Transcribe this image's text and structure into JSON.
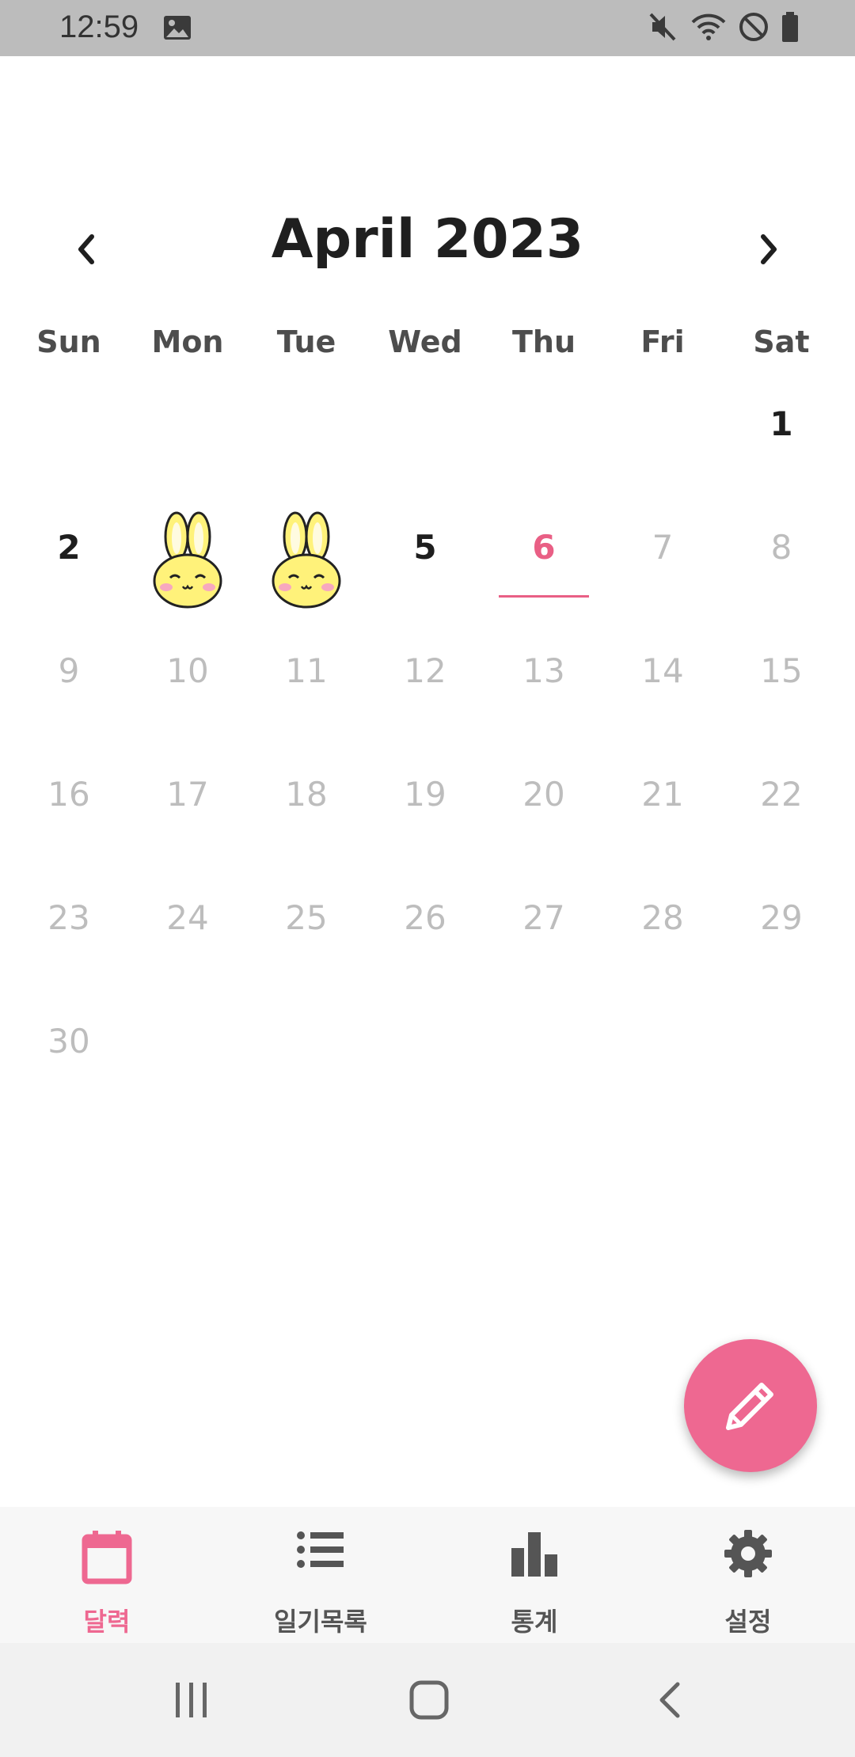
{
  "status_bar": {
    "time": "12:59",
    "left_icons": [
      "image-icon"
    ],
    "right_icons": [
      "mute-icon",
      "wifi-icon",
      "do-not-disturb-icon",
      "battery-icon"
    ]
  },
  "header": {
    "title": "April 2023",
    "prev_icon": "chevron-left-icon",
    "next_icon": "chevron-right-icon"
  },
  "weekdays": [
    "Sun",
    "Mon",
    "Tue",
    "Wed",
    "Thu",
    "Fri",
    "Sat"
  ],
  "calendar": {
    "month": "April",
    "year": 2023,
    "first_weekday": "Sat",
    "days_in_month": 30,
    "today": 6,
    "mood_days": [
      3,
      4
    ],
    "mood_icon": "yellow-bunny-icon"
  },
  "fab": {
    "icon": "pencil-icon"
  },
  "bottom_nav": {
    "tabs": [
      {
        "label": "달력",
        "icon": "calendar-icon",
        "active": true
      },
      {
        "label": "일기목록",
        "icon": "list-icon",
        "active": false
      },
      {
        "label": "통계",
        "icon": "bar-chart-icon",
        "active": false
      },
      {
        "label": "설정",
        "icon": "gear-icon",
        "active": false
      }
    ]
  },
  "system_nav": {
    "icons": [
      "recent-apps-icon",
      "home-icon",
      "back-icon"
    ]
  },
  "colors": {
    "accent": "#ee6891",
    "today": "#e95f85",
    "future_day": "#bdbdbd",
    "status_bar": "#bcbcbc"
  }
}
